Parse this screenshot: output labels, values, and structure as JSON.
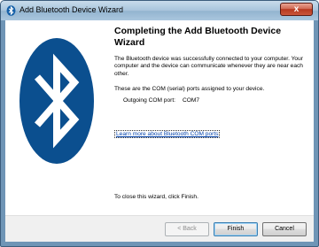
{
  "window": {
    "title": "Add Bluetooth Device Wizard",
    "close_glyph": "x",
    "title_icon": "bluetooth-icon"
  },
  "emblem": {
    "icon": "bluetooth-logo-icon",
    "colors": {
      "circle": "#0b4f8f",
      "rune": "#ffffff"
    }
  },
  "content": {
    "heading": "Completing the Add Bluetooth Device Wizard",
    "paragraph1": "The Bluetooth device was successfully connected to your computer. Your computer and the device can communicate whenever they are near each other.",
    "paragraph2": "These are the COM (serial) ports assigned to your device.",
    "port_label": "Outgoing COM port:",
    "port_value": "COM7",
    "link": "Learn more about Bluetooth COM ports",
    "close_note": "To close this wizard, click Finish."
  },
  "buttons": {
    "back": "< Back",
    "finish": "Finish",
    "cancel": "Cancel"
  }
}
